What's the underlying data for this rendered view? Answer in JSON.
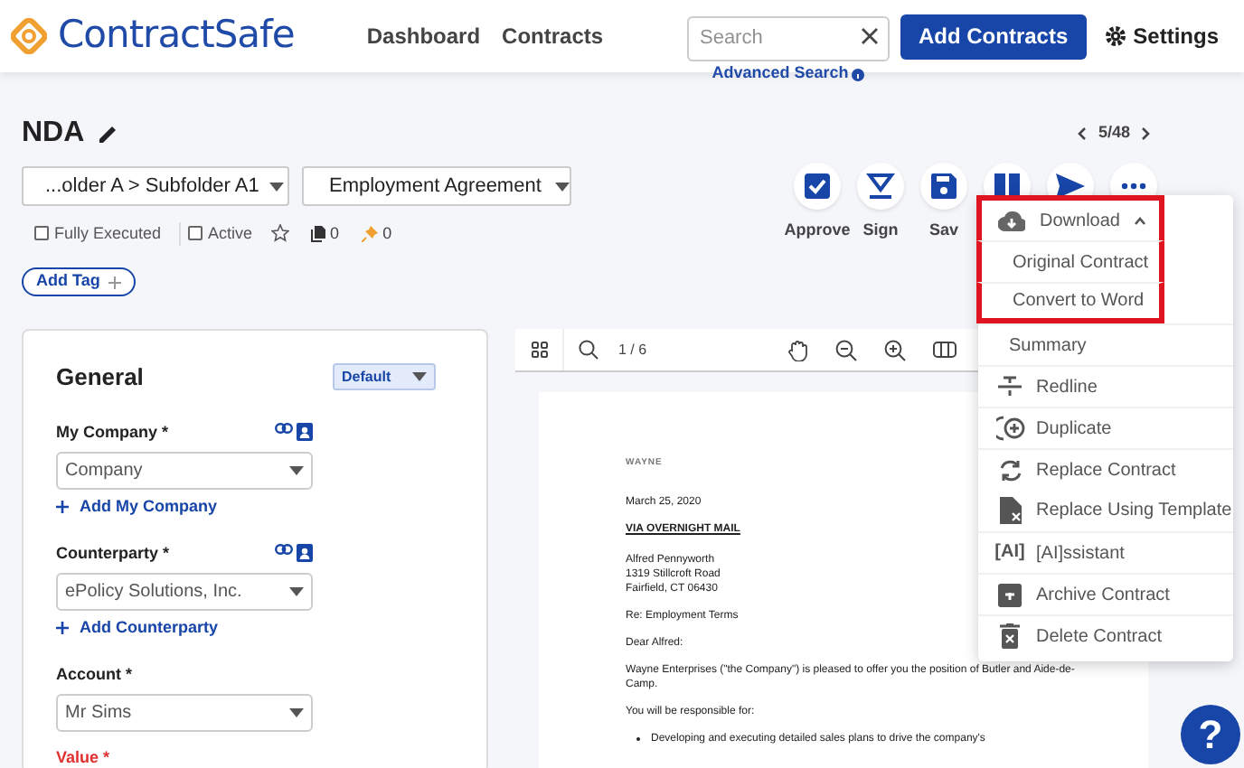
{
  "header": {
    "logo": "ContractSafe",
    "nav": [
      {
        "label": "Dashboard"
      },
      {
        "label": "Contracts"
      }
    ],
    "search": {
      "placeholder": "Search"
    },
    "advanced_search": "Advanced Search",
    "add_button": "Add Contracts",
    "settings": "Settings"
  },
  "contract": {
    "title": "NDA",
    "pager": "5/48",
    "folder": "...older A > Subfolder A1",
    "type": "Employment Agreement",
    "flags": [
      {
        "label": "Fully Executed",
        "checked": false
      },
      {
        "label": "Active",
        "checked": false
      }
    ],
    "starred": false,
    "files_count": "0",
    "pins_count": "0",
    "add_tag": "Add Tag"
  },
  "actions": [
    {
      "kind": "approve",
      "label": "Approve"
    },
    {
      "kind": "sign",
      "label": "Sign"
    },
    {
      "kind": "save",
      "label": "Sav"
    },
    {
      "kind": "columns"
    },
    {
      "kind": "send"
    },
    {
      "kind": "more"
    }
  ],
  "general": {
    "title": "General",
    "view": "Default",
    "fields": [
      {
        "label": "My Company *",
        "value": "Company",
        "add": "Add My Company"
      },
      {
        "label": "Counterparty *",
        "value": "ePolicy Solutions, Inc.",
        "add": "Add Counterparty"
      },
      {
        "label": "Account *",
        "value": "Mr Sims"
      }
    ],
    "next_label": "Value *"
  },
  "viewer": {
    "page": "1 / 6",
    "document": [
      {
        "kind": "logo",
        "text": "WAYNE"
      },
      {
        "kind": "p",
        "text": "March 25, 2020"
      },
      {
        "kind": "heading",
        "text": "VIA OVERNIGHT MAIL"
      },
      {
        "kind": "address",
        "text": "Alfred Pennyworth\n1319 Stillcroft Road\nFairfield, CT 06430"
      },
      {
        "kind": "p",
        "text": "Re: Employment Terms"
      },
      {
        "kind": "p",
        "text": "Dear Alfred:"
      },
      {
        "kind": "p",
        "text": "Wayne Enterprises (\"the Company\") is pleased to offer you the position of Butler and Aide-de-Camp."
      },
      {
        "kind": "p",
        "text": "You will be responsible for:"
      },
      {
        "kind": "bullet",
        "text": "Developing and executing detailed sales plans to drive the company's"
      }
    ]
  },
  "menu": {
    "items": [
      {
        "kind": "download",
        "label": "Download",
        "expanded": true,
        "highlighted": true
      },
      {
        "kind": "sub",
        "label": "Original Contract",
        "highlighted": true
      },
      {
        "kind": "sub",
        "label": "Convert to Word",
        "highlighted": true
      },
      {
        "kind": "sub",
        "label": "Summary",
        "highlighted": false
      },
      {
        "kind": "redline",
        "label": "Redline",
        "highlighted": false
      },
      {
        "kind": "duplicate",
        "label": "Duplicate",
        "highlighted": false
      },
      {
        "kind": "replace",
        "label": "Replace Contract",
        "highlighted": false
      },
      {
        "kind": "template",
        "label": "Replace Using Template",
        "highlighted": false
      },
      {
        "kind": "ai",
        "icon_text": "[AI]",
        "label": "[AI]ssistant",
        "highlighted": false
      },
      {
        "kind": "archive",
        "label": "Archive Contract",
        "highlighted": false
      },
      {
        "kind": "delete",
        "label": "Delete Contract",
        "highlighted": false
      }
    ]
  },
  "help": "?"
}
